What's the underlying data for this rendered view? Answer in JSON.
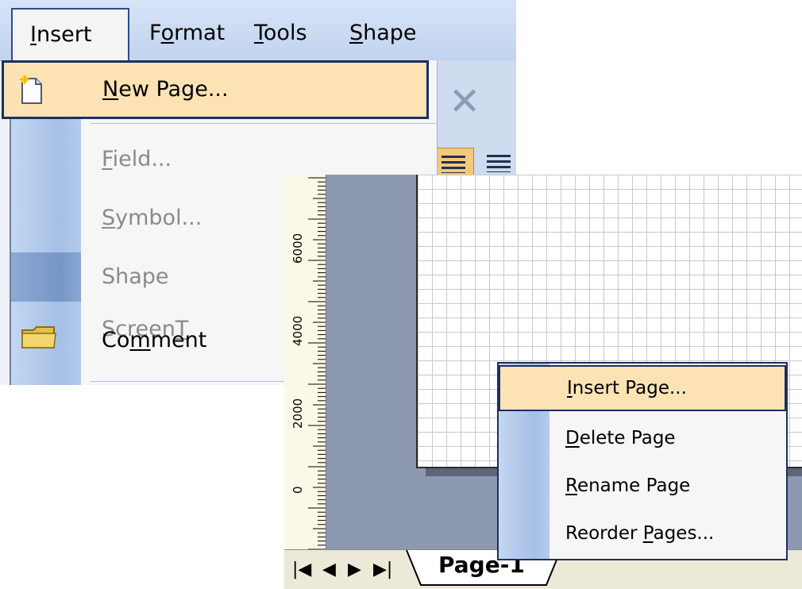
{
  "menubar": {
    "items": [
      {
        "pre": "",
        "key": "I",
        "post": "nsert"
      },
      {
        "pre": "F",
        "key": "o",
        "post": "rmat"
      },
      {
        "pre": "",
        "key": "T",
        "post": "ools"
      },
      {
        "pre": "",
        "key": "S",
        "post": "hape"
      }
    ]
  },
  "insert_menu": {
    "items": [
      {
        "pre": "",
        "key": "N",
        "post": "ew Page...",
        "enabled": true,
        "highlighted": true,
        "icon": "new-page-icon"
      },
      {
        "pre": "",
        "key": "F",
        "post": "ield...",
        "enabled": false
      },
      {
        "pre": "",
        "key": "S",
        "post": "ymbol...",
        "enabled": false
      },
      {
        "pre": "Shape Screen",
        "key": "T",
        "post": "",
        "enabled": false
      },
      {
        "pre": "Co",
        "key": "m",
        "post": "ment",
        "enabled": true,
        "icon": "comment-folder-icon"
      }
    ]
  },
  "ruler": {
    "labels": [
      "6000",
      "4000",
      "2000",
      "0"
    ]
  },
  "page_tabs": {
    "nav": [
      "⏮",
      "◀",
      "▶",
      "⏭"
    ],
    "active_tab": "Page-1"
  },
  "context_menu": {
    "items": [
      {
        "pre": "",
        "key": "I",
        "post": "nsert Page...",
        "highlighted": true
      },
      {
        "pre": "",
        "key": "D",
        "post": "elete Page"
      },
      {
        "pre": "",
        "key": "R",
        "post": "ename Page"
      },
      {
        "pre": "Reorder ",
        "key": "P",
        "post": "ages..."
      }
    ]
  },
  "colors": {
    "highlight": "#fde3b4",
    "highlight_border": "#1b2f63",
    "menu_strip": "#a5bfe6",
    "canvas_bg": "#8c99b0"
  }
}
